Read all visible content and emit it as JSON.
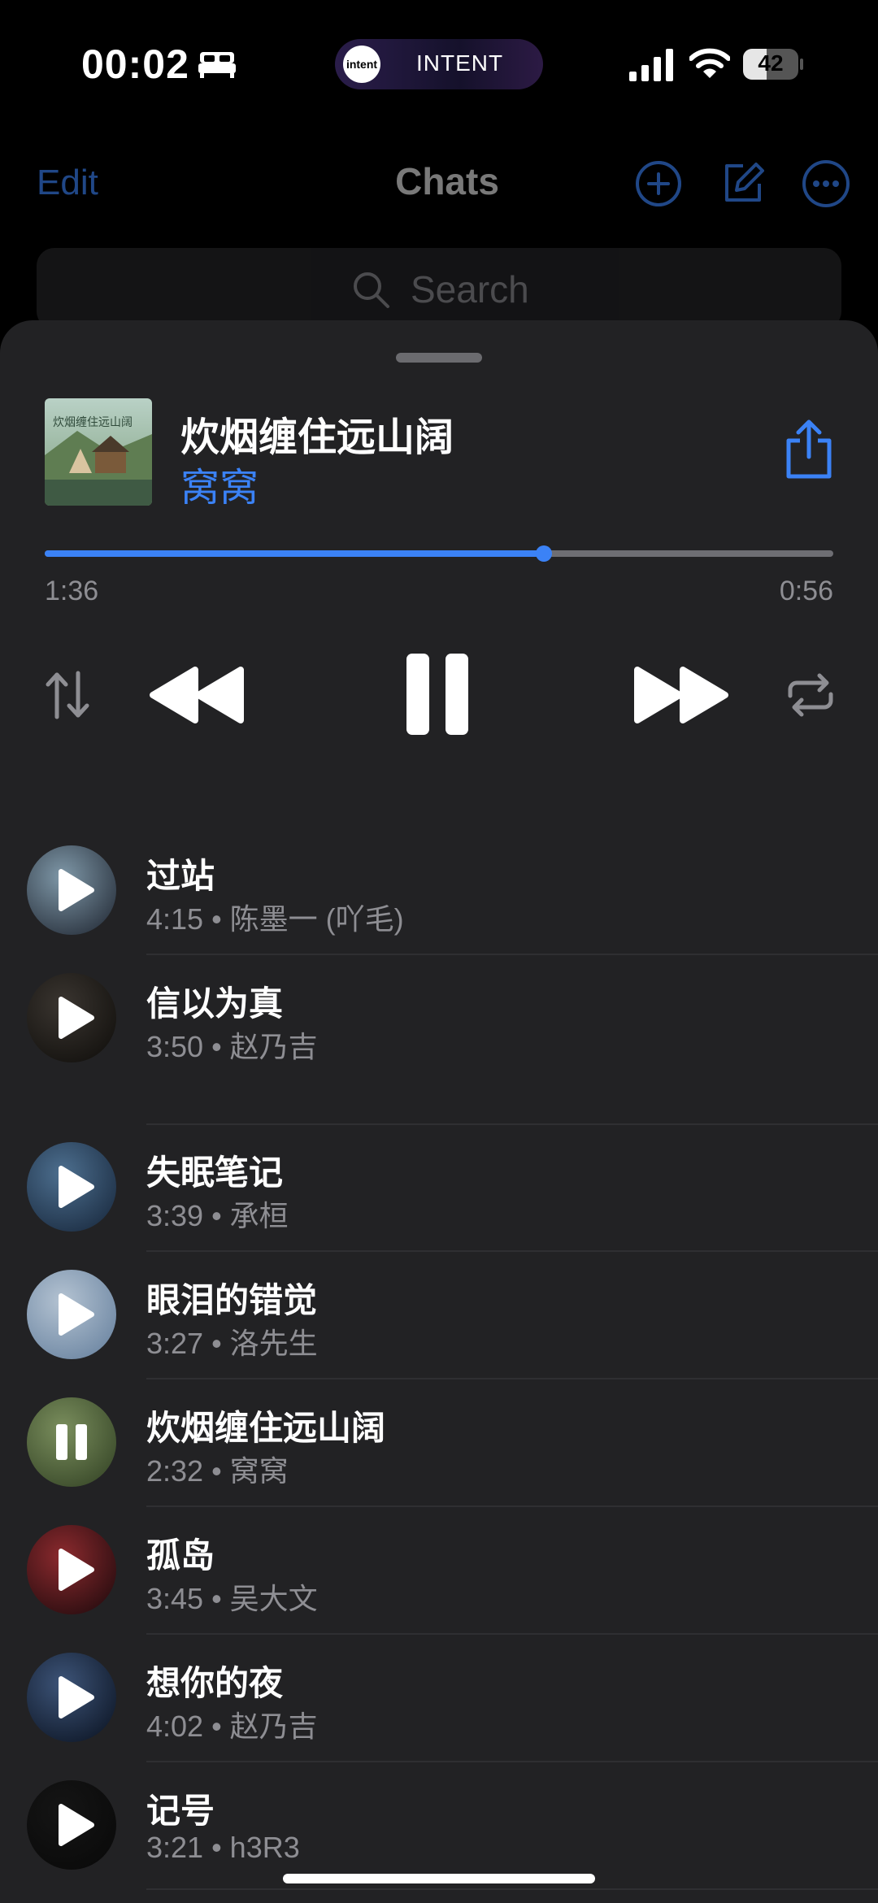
{
  "status": {
    "time": "00:02",
    "island_app": "INTENT",
    "island_logo": "intent",
    "battery": "42",
    "battery_level": 0.42
  },
  "chats": {
    "edit_label": "Edit",
    "title": "Chats",
    "search_placeholder": "Search"
  },
  "player": {
    "title": "炊烟缠住远山阔",
    "artist": "窝窝",
    "elapsed": "1:36",
    "remaining": "0:56",
    "progress": 0.633,
    "accent": "#3b82f6"
  },
  "tracks": [
    {
      "title": "过站",
      "meta": "4:15 • 陈墨一 (吖毛)",
      "state": "play",
      "thumb": [
        "#7f98a8",
        "#2b3440"
      ]
    },
    {
      "title": "信以为真",
      "meta": "3:50 • 赵乃吉",
      "state": "play",
      "thumb": [
        "#3a3530",
        "#14120f"
      ]
    },
    {
      "title": "失眠笔记",
      "meta": "3:39 • 承桓",
      "state": "play",
      "thumb": [
        "#4d6f8f",
        "#1d2f45"
      ]
    },
    {
      "title": "眼泪的错觉",
      "meta": "3:27 • 洛先生",
      "state": "play",
      "thumb": [
        "#b4c3d2",
        "#6e87a3"
      ]
    },
    {
      "title": "炊烟缠住远山阔",
      "meta": "2:32 • 窝窝",
      "state": "pause",
      "thumb": [
        "#7a8e5d",
        "#3a4a2a"
      ]
    },
    {
      "title": "孤岛",
      "meta": "3:45 • 吴大文",
      "state": "play",
      "thumb": [
        "#8c2a2e",
        "#2a0d10"
      ]
    },
    {
      "title": "想你的夜",
      "meta": "4:02 • 赵乃吉",
      "state": "play",
      "thumb": [
        "#3d5478",
        "#101a2b"
      ]
    },
    {
      "title": "记号",
      "meta": "3:21 • h3R3",
      "state": "play",
      "thumb": [
        "#151515",
        "#0a0a0a"
      ]
    }
  ]
}
